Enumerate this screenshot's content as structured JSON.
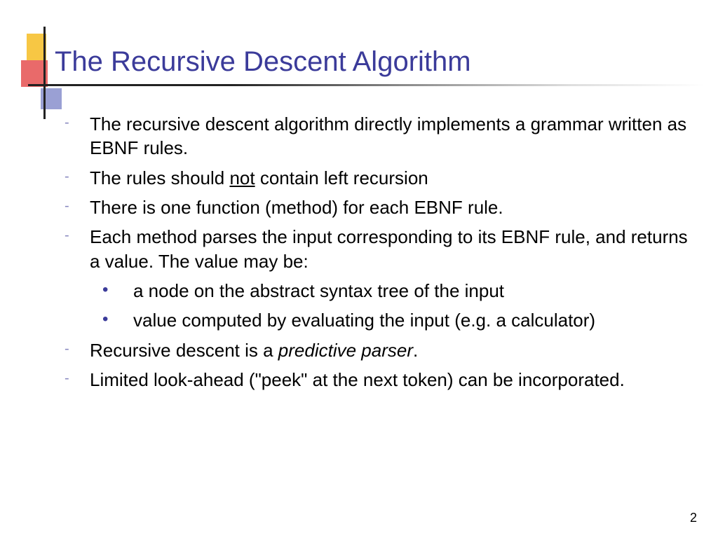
{
  "title": "The Recursive Descent Algorithm",
  "bullets": [
    {
      "type": "dash",
      "segments": [
        {
          "t": "The recursive descent algorithm directly implements a grammar written as EBNF rules."
        }
      ]
    },
    {
      "type": "dash",
      "segments": [
        {
          "t": "The rules should "
        },
        {
          "t": "not",
          "cls": "underline"
        },
        {
          "t": " contain left recursion"
        }
      ]
    },
    {
      "type": "dash",
      "segments": [
        {
          "t": "There is one function (method) for each EBNF rule."
        }
      ]
    },
    {
      "type": "dash",
      "segments": [
        {
          "t": "Each method parses the input corresponding to its EBNF rule, and returns a value.  The value may be:"
        }
      ]
    },
    {
      "type": "dot",
      "segments": [
        {
          "t": "a node on the abstract syntax tree of the input"
        }
      ]
    },
    {
      "type": "dot",
      "segments": [
        {
          "t": "value computed by evaluating the input (e.g. a calculator)"
        }
      ]
    },
    {
      "type": "dash",
      "segments": [
        {
          "t": "Recursive descent is a "
        },
        {
          "t": "predictive parser",
          "cls": "italic"
        },
        {
          "t": "."
        }
      ]
    },
    {
      "type": "dash",
      "segments": [
        {
          "t": "Limited look-ahead (\"peek\" at the next token) can be incorporated."
        }
      ]
    }
  ],
  "pageNumber": "2"
}
